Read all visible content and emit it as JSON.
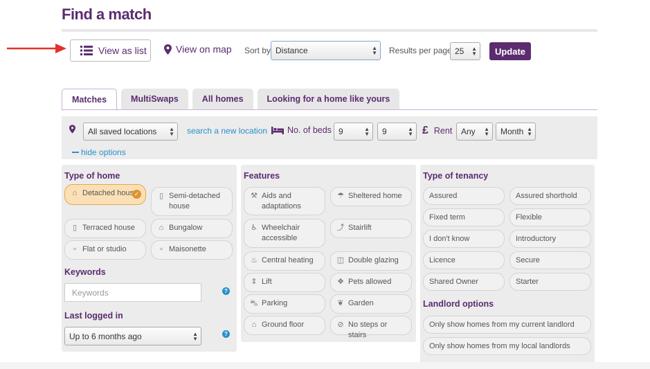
{
  "page": {
    "title": "Find a match"
  },
  "toolbar": {
    "view_list_label": "View as list",
    "view_map_label": "View on map",
    "sort_label": "Sort by",
    "sort_value": "Distance",
    "rpp_label": "Results per page",
    "rpp_value": "25",
    "update_label": "Update"
  },
  "tabs": [
    {
      "label": "Matches",
      "active": true
    },
    {
      "label": "MultiSwaps",
      "active": false
    },
    {
      "label": "All homes",
      "active": false
    },
    {
      "label": "Looking for a home like yours",
      "active": false
    }
  ],
  "filters": {
    "location_value": "All saved locations",
    "search_location_link": "search a new location",
    "beds_label": "No. of beds",
    "beds_min": "9",
    "beds_max": "9",
    "rent_symbol": "£",
    "rent_label": "Rent",
    "rent_amount": "Any",
    "rent_period": "Month",
    "hide_options_label": "hide options"
  },
  "type_of_home": {
    "heading": "Type of home",
    "items": [
      {
        "label": "Detached house",
        "icon": "house-icon",
        "selected": true
      },
      {
        "label": "Semi-detached house",
        "icon": "semi-house-icon",
        "selected": false
      },
      {
        "label": "Terraced house",
        "icon": "terraced-icon",
        "selected": false
      },
      {
        "label": "Bungalow",
        "icon": "bungalow-icon",
        "selected": false
      },
      {
        "label": "Flat or studio",
        "icon": "flat-icon",
        "selected": false
      },
      {
        "label": "Maisonette",
        "icon": "maisonette-icon",
        "selected": false
      }
    ],
    "keywords_heading": "Keywords",
    "keywords_placeholder": "Keywords",
    "last_logged_heading": "Last logged in",
    "last_logged_value": "Up to 6 months ago"
  },
  "features": {
    "heading": "Features",
    "items": [
      {
        "label": "Aids and adaptations",
        "icon": "wrench-icon"
      },
      {
        "label": "Sheltered home",
        "icon": "umbrella-icon"
      },
      {
        "label": "Wheelchair accessible",
        "icon": "wheelchair-icon"
      },
      {
        "label": "Stairlift",
        "icon": "stairlift-icon"
      },
      {
        "label": "Central heating",
        "icon": "flame-icon"
      },
      {
        "label": "Double glazing",
        "icon": "window-icon"
      },
      {
        "label": "Lift",
        "icon": "lift-icon"
      },
      {
        "label": "Pets allowed",
        "icon": "paw-icon"
      },
      {
        "label": "Parking",
        "icon": "car-icon"
      },
      {
        "label": "Garden",
        "icon": "plant-icon"
      },
      {
        "label": "Ground floor",
        "icon": "ground-floor-icon"
      },
      {
        "label": "No steps or stairs",
        "icon": "no-steps-icon"
      }
    ]
  },
  "tenancy": {
    "heading": "Type of tenancy",
    "items": [
      "Assured",
      "Assured shorthold",
      "Fixed term",
      "Flexible",
      "I don't know",
      "Introductory",
      "Licence",
      "Secure",
      "Shared Owner",
      "Starter"
    ],
    "landlord_heading": "Landlord options",
    "landlord_items": [
      "Only show homes from my current landlord",
      "Only show homes from my local landlords"
    ]
  },
  "colors": {
    "brand": "#5b2c6f",
    "link": "#2a8fc9",
    "selected": "#fbe0b5",
    "accent_red": "#e53228"
  }
}
